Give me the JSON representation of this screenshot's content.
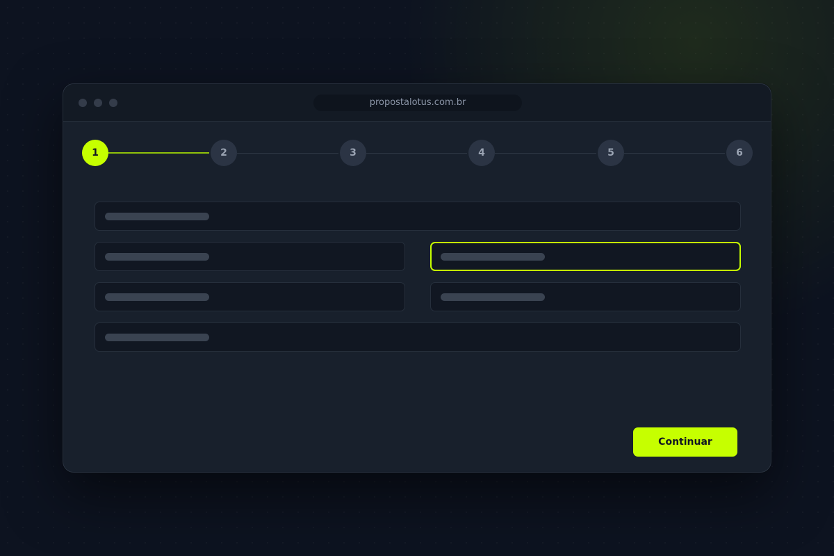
{
  "browser": {
    "url": "propostalotus.com.br"
  },
  "stepper": {
    "current_step": 1,
    "steps": [
      "1",
      "2",
      "3",
      "4",
      "5",
      "6"
    ]
  },
  "form": {
    "fields": [
      {
        "placeholder_text": "",
        "focused": false
      },
      {
        "placeholder_text": "",
        "focused": false
      },
      {
        "placeholder_text": "",
        "focused": true
      },
      {
        "placeholder_text": "",
        "focused": false
      },
      {
        "placeholder_text": "",
        "focused": false
      },
      {
        "placeholder_text": "",
        "focused": false
      }
    ]
  },
  "actions": {
    "continue_label": "Continuar"
  },
  "colors": {
    "accent": "#c6ff00",
    "window_background": "#18202c",
    "page_background": "#0d1320"
  }
}
